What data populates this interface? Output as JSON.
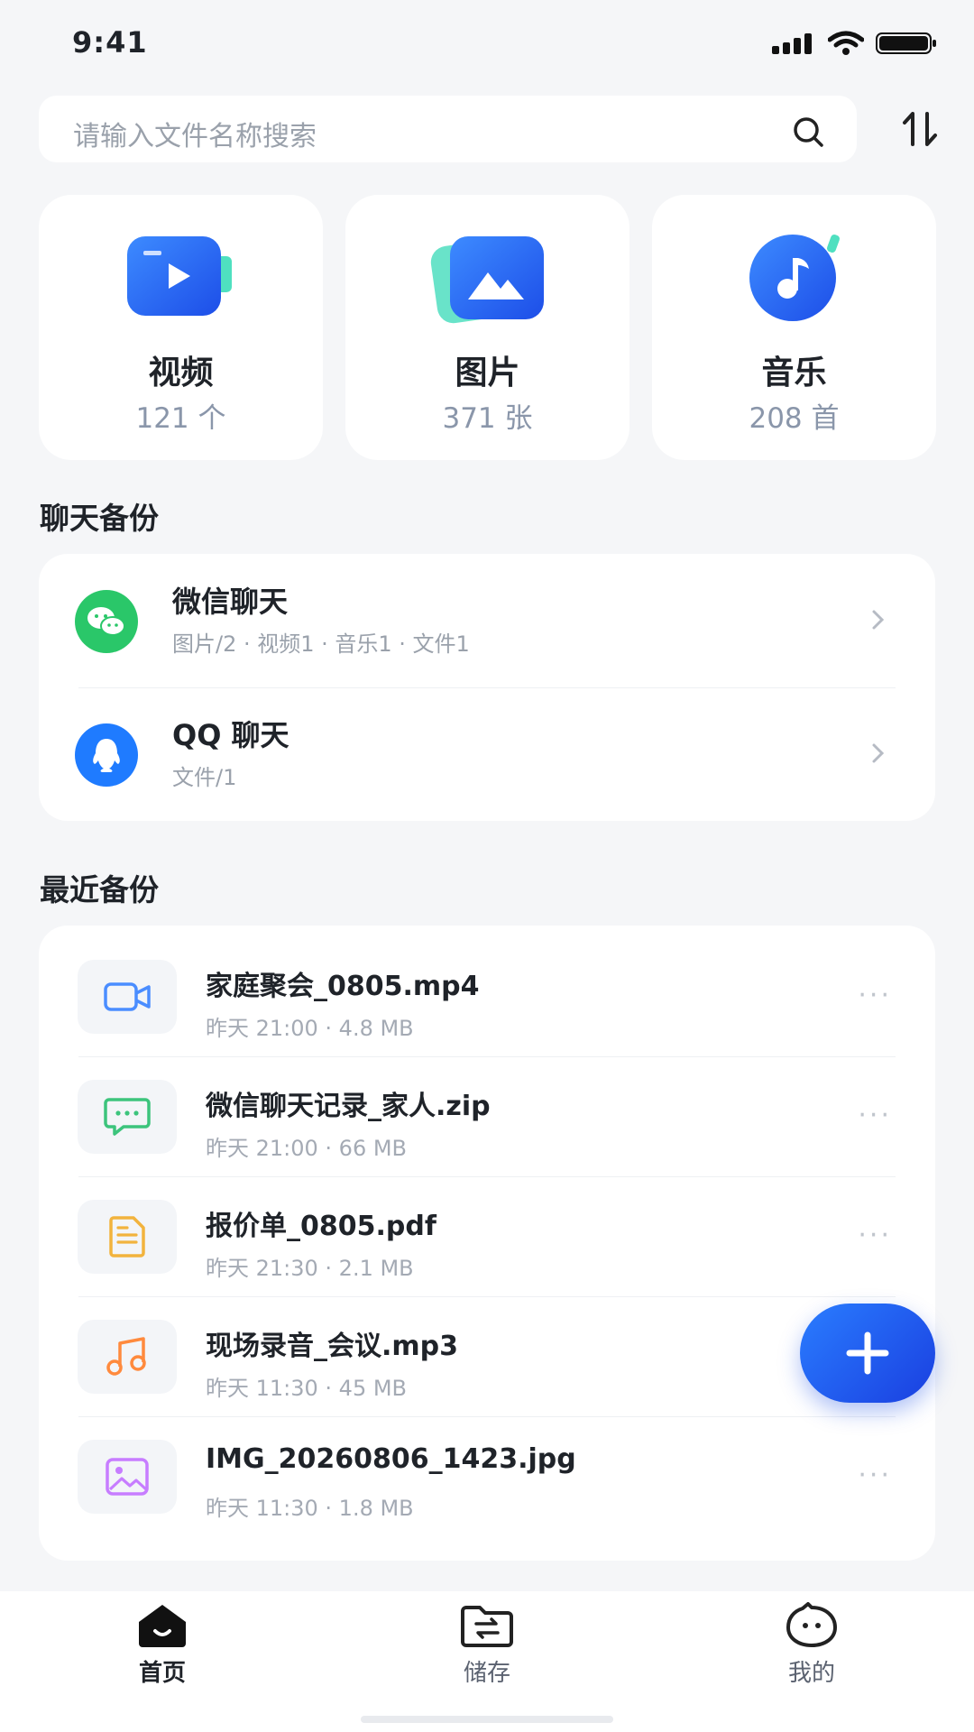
{
  "status_bar": {
    "time": "9:41"
  },
  "search": {
    "placeholder": "请输入文件名称搜索"
  },
  "categories": [
    {
      "name": "视频",
      "count": "121 个"
    },
    {
      "name": "图片",
      "count": "371 张"
    },
    {
      "name": "音乐",
      "count": "208 首"
    }
  ],
  "chat_backup": {
    "title": "聊天备份",
    "items": [
      {
        "name": "微信聊天",
        "meta": "图片/2 · 视频1 · 音乐1 · 文件1"
      },
      {
        "name": "QQ 聊天",
        "meta": "文件/1"
      }
    ]
  },
  "recent_backup": {
    "title": "最近备份",
    "files": [
      {
        "name": "家庭聚会_0805.mp4",
        "meta": "昨天 21:00 · 4.8 MB",
        "icon": "video-file-icon",
        "color": "#4a8dff"
      },
      {
        "name": "微信聊天记录_家人.zip",
        "meta": "昨天 21:00 · 66 MB",
        "icon": "chat-file-icon",
        "color": "#3cc47c"
      },
      {
        "name": "报价单_0805.pdf",
        "meta": "昨天 21:30 · 2.1 MB",
        "icon": "document-file-icon",
        "color": "#f2b33d"
      },
      {
        "name": "现场录音_会议.mp3",
        "meta": "昨天 11:30 · 45 MB",
        "icon": "audio-file-icon",
        "color": "#ff8a3d"
      },
      {
        "name": "IMG_20260806_1423.jpg",
        "meta": "昨天 11:30 · 1.8 MB",
        "icon": "image-file-icon",
        "color": "#c77dff"
      }
    ]
  },
  "tabs": [
    {
      "label": "首页",
      "active": true
    },
    {
      "label": "储存",
      "active": false
    },
    {
      "label": "我的",
      "active": false
    }
  ],
  "colors": {
    "accent": "#2a6bff",
    "wechat": "#2ac769",
    "qq": "#1f7bff"
  }
}
